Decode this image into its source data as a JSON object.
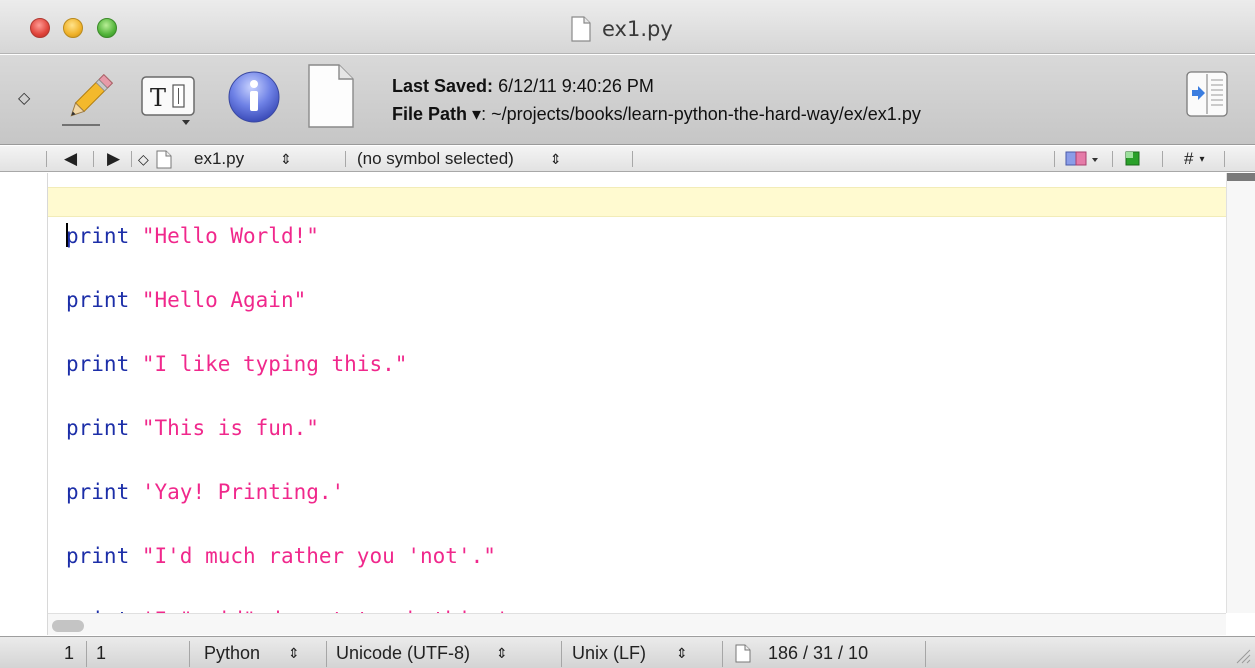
{
  "window": {
    "title": "ex1.py"
  },
  "toolbar": {
    "last_saved_label": "Last Saved:",
    "last_saved_value": "6/12/11 9:40:26 PM",
    "file_path_label": "File Path",
    "file_path_arrow": "▾",
    "file_path_sep": ":",
    "file_path_value": "~/projects/books/learn-python-the-hard-way/ex/ex1.py"
  },
  "navbar": {
    "back": "◀",
    "forward": "▶",
    "diamond": "◇",
    "file_name": "ex1.py",
    "file_updown": "⇕",
    "symbol": "(no symbol selected)",
    "symbol_updown": "⇕",
    "hash": "#"
  },
  "editor": {
    "lines": [
      {
        "kw": "print",
        "str": "\"Hello World!\""
      },
      {
        "kw": "print",
        "str": "\"Hello Again\""
      },
      {
        "kw": "print",
        "str": "\"I like typing this.\""
      },
      {
        "kw": "print",
        "str": "\"This is fun.\""
      },
      {
        "kw": "print",
        "str": "'Yay! Printing.'"
      },
      {
        "kw": "print",
        "str": "\"I'd much rather you 'not'.\""
      },
      {
        "kw": "print",
        "str": "'I \"said\" do not touch this.'"
      }
    ],
    "colors": {
      "keyword": "#1c2ea8",
      "string": "#f0288c",
      "current_line": "#fffad0"
    }
  },
  "statusbar": {
    "line": "1",
    "column": "1",
    "language": "Python",
    "encoding": "Unicode (UTF-8)",
    "line_endings": "Unix (LF)",
    "updown": "⇕",
    "stats": "186 / 31 / 10"
  }
}
